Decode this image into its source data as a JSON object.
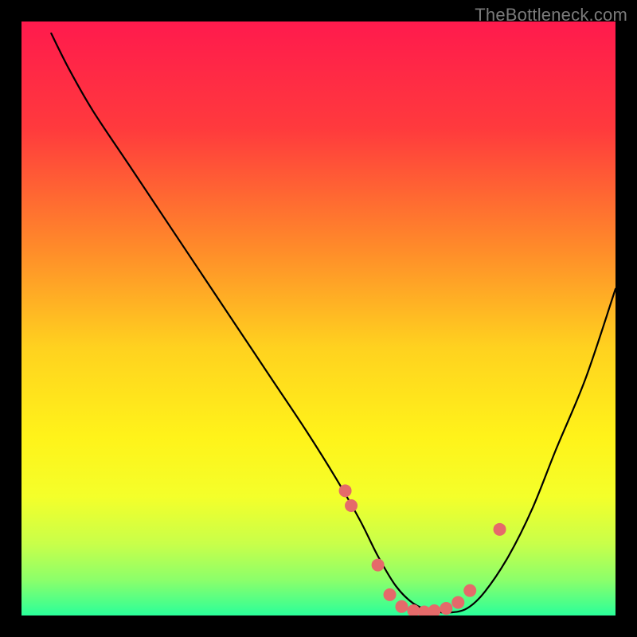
{
  "watermark": "TheBottleneck.com",
  "chart_data": {
    "type": "line",
    "title": "",
    "xlabel": "",
    "ylabel": "",
    "xlim": [
      0,
      100
    ],
    "ylim": [
      0,
      100
    ],
    "gradient_stops": [
      {
        "offset": 0,
        "color": "#ff1a4d"
      },
      {
        "offset": 18,
        "color": "#ff3a3d"
      },
      {
        "offset": 38,
        "color": "#ff8a2a"
      },
      {
        "offset": 55,
        "color": "#ffd21f"
      },
      {
        "offset": 70,
        "color": "#fff31a"
      },
      {
        "offset": 80,
        "color": "#f4ff2a"
      },
      {
        "offset": 88,
        "color": "#c8ff4a"
      },
      {
        "offset": 94,
        "color": "#8cff6a"
      },
      {
        "offset": 100,
        "color": "#2aff9a"
      }
    ],
    "series": [
      {
        "name": "bottleneck-curve",
        "x": [
          5,
          8,
          12,
          18,
          24,
          30,
          36,
          42,
          48,
          53,
          57,
          60,
          63,
          66,
          69,
          72,
          75,
          78,
          82,
          86,
          90,
          95,
          100
        ],
        "y": [
          98,
          92,
          85,
          76,
          67,
          58,
          49,
          40,
          31,
          23,
          16,
          10,
          5,
          2,
          0.8,
          0.5,
          1.2,
          4,
          10,
          18,
          28,
          40,
          55
        ]
      }
    ],
    "scatter": {
      "name": "highlighted-points",
      "color": "#e56a6a",
      "radius": 8,
      "points": [
        {
          "x": 54.5,
          "y": 21
        },
        {
          "x": 55.5,
          "y": 18.5
        },
        {
          "x": 60,
          "y": 8.5
        },
        {
          "x": 62,
          "y": 3.5
        },
        {
          "x": 64,
          "y": 1.5
        },
        {
          "x": 66,
          "y": 0.8
        },
        {
          "x": 67.8,
          "y": 0.6
        },
        {
          "x": 69.5,
          "y": 0.8
        },
        {
          "x": 71.5,
          "y": 1.2
        },
        {
          "x": 73.5,
          "y": 2.2
        },
        {
          "x": 75.5,
          "y": 4.2
        },
        {
          "x": 80.5,
          "y": 14.5
        }
      ]
    },
    "tick_labels": {
      "x": [],
      "y": []
    },
    "legend": []
  }
}
